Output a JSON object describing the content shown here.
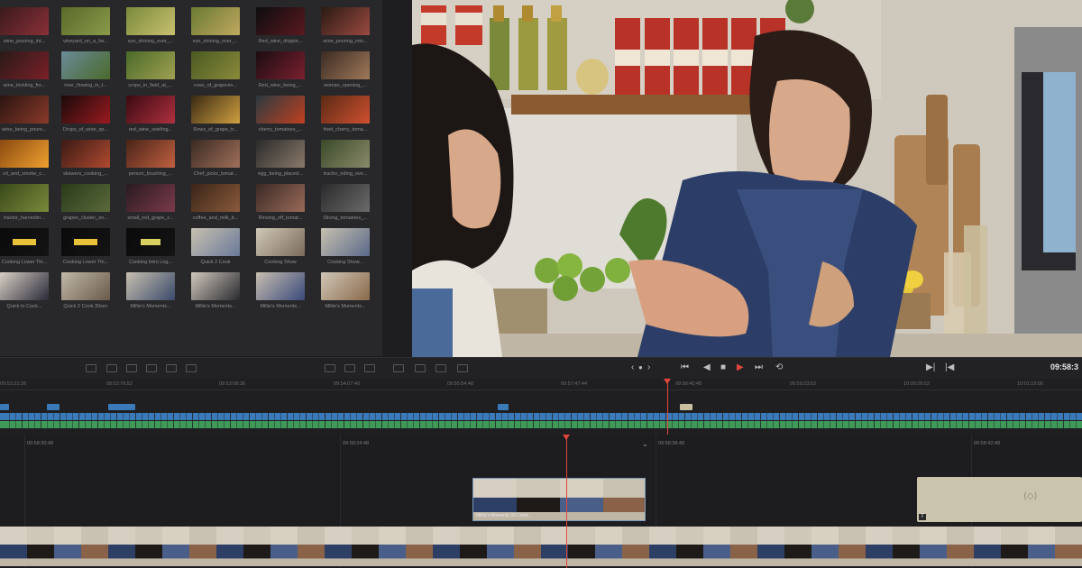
{
  "media_pool": {
    "clips": [
      {
        "name": "wine_pouring_int...",
        "c1": "#3a1a1c",
        "c2": "#8a3038"
      },
      {
        "name": "vineyard_on_a_far...",
        "c1": "#5a6a2a",
        "c2": "#8a9a4a"
      },
      {
        "name": "sun_shining_over_...",
        "c1": "#7a8a3a",
        "c2": "#c8c070"
      },
      {
        "name": "sun_shining_over_...",
        "c1": "#6a7a32",
        "c2": "#c0a860"
      },
      {
        "name": "Red_wine_drippin...",
        "c1": "#0c0c0e",
        "c2": "#5a1a20"
      },
      {
        "name": "wine_pouring_into...",
        "c1": "#2a1a14",
        "c2": "#9a4a40"
      },
      {
        "name": "wine_trickling_fro...",
        "c1": "#2a1a18",
        "c2": "#7a2028"
      },
      {
        "name": "river_flowing_in_t...",
        "c1": "#6a8a9a",
        "c2": "#4a6a2a"
      },
      {
        "name": "crops_in_field_at_...",
        "c1": "#4a6a2a",
        "c2": "#a0a050"
      },
      {
        "name": "rows_of_grapevin...",
        "c1": "#4a5a22",
        "c2": "#8a8a3a"
      },
      {
        "name": "Red_wine_being_...",
        "c1": "#1a0c10",
        "c2": "#7a2030"
      },
      {
        "name": "woman_opening_...",
        "c1": "#3a2a22",
        "c2": "#a07a5a"
      },
      {
        "name": "wine_being_poure...",
        "c1": "#2a1410",
        "c2": "#8a3a2a"
      },
      {
        "name": "Drops_of_wine_sp...",
        "c1": "#1a0a0a",
        "c2": "#9a1a20"
      },
      {
        "name": "red_wine_swirling...",
        "c1": "#3a0a10",
        "c2": "#b03040"
      },
      {
        "name": "Rows_of_grape_tr...",
        "c1": "#3a2a14",
        "c2": "#d0a040"
      },
      {
        "name": "cherry_tomatoes_...",
        "c1": "#2a3a40",
        "c2": "#c04020"
      },
      {
        "name": "fried_cherry_toma...",
        "c1": "#5a2a14",
        "c2": "#d05030"
      },
      {
        "name": "oil_and_smoke_c...",
        "c1": "#8a4a10",
        "c2": "#f0a030"
      },
      {
        "name": "skewers_cooking_...",
        "c1": "#3a1a14",
        "c2": "#b04a30"
      },
      {
        "name": "person_brushing_...",
        "c1": "#4a2418",
        "c2": "#c06040"
      },
      {
        "name": "Chef_picks_tomat...",
        "c1": "#3a2a22",
        "c2": "#a0705a"
      },
      {
        "name": "egg_being_placed...",
        "c1": "#2a2a2a",
        "c2": "#8a7a6a"
      },
      {
        "name": "tractor_riding_ove...",
        "c1": "#3a4a2a",
        "c2": "#8a8a6a"
      },
      {
        "name": "tractor_harvestin...",
        "c1": "#3a4a1a",
        "c2": "#7a8a3a"
      },
      {
        "name": "grapes_cluster_on...",
        "c1": "#2a3a1a",
        "c2": "#5a6a3a"
      },
      {
        "name": "small_red_grape_c...",
        "c1": "#2a1a20",
        "c2": "#7a3a4a"
      },
      {
        "name": "coffee_and_milk_b...",
        "c1": "#3a2418",
        "c2": "#8a5a3a"
      },
      {
        "name": "Rinsing_off_tomat...",
        "c1": "#3a2a24",
        "c2": "#9a6a5a"
      },
      {
        "name": "Slicing_tomatoes_...",
        "c1": "#2a2a2c",
        "c2": "#6a6a6a"
      },
      {
        "name": "Cooking Lower Thi...",
        "c1": "#0a0a0a",
        "c2": "#141414",
        "lt": true
      },
      {
        "name": "Cooking Lower Thi...",
        "c1": "#0a0a0a",
        "c2": "#141414",
        "lt": true
      },
      {
        "name": "Cooking Intro Log...",
        "c1": "#0a0a0a",
        "c2": "#141414",
        "lt": true,
        "wide": true
      },
      {
        "name": "Quick 2 Cook",
        "c1": "#c8c0b0",
        "c2": "#6a7a9a"
      },
      {
        "name": "Cooking Show",
        "c1": "#d0c8b8",
        "c2": "#7a6a5a"
      },
      {
        "name": "Cooking Show...",
        "c1": "#c8c0b0",
        "c2": "#5a6a8a"
      },
      {
        "name": "Quick to Cook...",
        "c1": "#d8d0c4",
        "c2": "#2a2a3a"
      },
      {
        "name": "Quick 2 Cook 30sec",
        "c1": "#c0b8a8",
        "c2": "#6a5a4a"
      },
      {
        "name": "Millie's Moments...",
        "c1": "#c8c0b0",
        "c2": "#3a4a6a"
      },
      {
        "name": "Millie's Moments...",
        "c1": "#d0c8bc",
        "c2": "#2a2a30"
      },
      {
        "name": "Millie's Moments...",
        "c1": "#c8beb0",
        "c2": "#3a4a7a"
      },
      {
        "name": "Millie's Moments...",
        "c1": "#d0c6b8",
        "c2": "#8a6a4a"
      }
    ]
  },
  "viewer": {
    "timecode": "09:58:3"
  },
  "upper_timeline": {
    "ruler_labels": [
      "09:52:22:28",
      "09:53:76:52",
      "09:53:08:36",
      "09:54:07:40",
      "09:55:54:48",
      "09:57:47:44",
      "09:58:40:48",
      "09:59:33:52",
      "10:00:26:52",
      "10:01:19:56"
    ]
  },
  "lower_timeline": {
    "ruler_labels": [
      "09:58:30:48",
      "09:58:34:48",
      "09:58:38:48",
      "09:58:42:48"
    ],
    "clip_label": "Millie's Moments 30 Cond..."
  },
  "colors": {
    "accent_red": "#e2463a",
    "audio_blue": "#3a7ab8",
    "audio_green": "#3f9a5a",
    "timecode_text": "#e6e6ea"
  }
}
